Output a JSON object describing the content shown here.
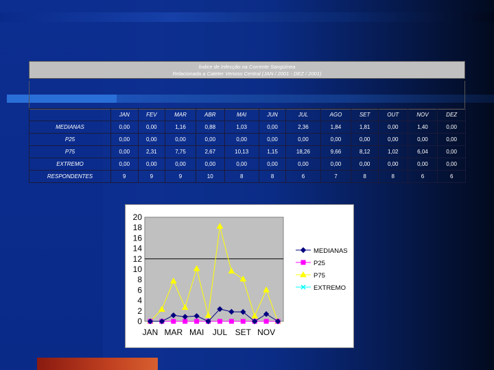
{
  "slide": {
    "title_line1": "Índice de Infecção na Corrente Sangüínea",
    "title_line2": "Relacionada a Cateter Venoso Central (JAN / 2001 - DEZ / 2001)"
  },
  "table": {
    "months": [
      "JAN",
      "FEV",
      "MAR",
      "ABR",
      "MAI",
      "JUN",
      "JUL",
      "AGO",
      "SET",
      "OUT",
      "NOV",
      "DEZ"
    ],
    "rows": [
      {
        "label": "MEDIANAS",
        "values": [
          "0,00",
          "0,00",
          "1,16",
          "0,88",
          "1,03",
          "0,00",
          "2,36",
          "1,84",
          "1,81",
          "0,00",
          "1,40",
          "0,00"
        ]
      },
      {
        "label": "P25",
        "values": [
          "0,00",
          "0,00",
          "0,00",
          "0,00",
          "0,00",
          "0,00",
          "0,00",
          "0,00",
          "0,00",
          "0,00",
          "0,00",
          "0,00"
        ]
      },
      {
        "label": "P75",
        "values": [
          "0,00",
          "2,31",
          "7,75",
          "2,67",
          "10,13",
          "1,15",
          "18,26",
          "9,66",
          "8,12",
          "1,02",
          "6,04",
          "0,00"
        ]
      },
      {
        "label": "EXTREMO",
        "values": [
          "0,00",
          "0,00",
          "0,00",
          "0,00",
          "0,00",
          "0,00",
          "0,00",
          "0,00",
          "0,00",
          "0,00",
          "0,00",
          "0,00"
        ]
      },
      {
        "label": "RESPONDENTES",
        "values": [
          "9",
          "9",
          "9",
          "10",
          "8",
          "8",
          "6",
          "7",
          "8",
          "8",
          "6",
          "6"
        ]
      }
    ]
  },
  "chart_data": {
    "type": "line",
    "x": [
      "JAN",
      "FEV",
      "MAR",
      "ABR",
      "MAI",
      "JUN",
      "JUL",
      "AGO",
      "SET",
      "OUT",
      "NOV",
      "DEZ"
    ],
    "xtick_labels": [
      "JAN",
      "",
      "MAR",
      "",
      "MAI",
      "",
      "JUL",
      "",
      "SET",
      "",
      "NOV",
      ""
    ],
    "ylim": [
      0,
      20
    ],
    "yticks": [
      0,
      2,
      4,
      6,
      8,
      10,
      12,
      14,
      16,
      18,
      20
    ],
    "gridline_at": 12,
    "series": [
      {
        "name": "MEDIANAS",
        "color": "#000080",
        "marker": "diamond",
        "values": [
          0,
          0,
          1.16,
          0.88,
          1.03,
          0,
          2.36,
          1.84,
          1.81,
          0,
          1.4,
          0
        ]
      },
      {
        "name": "P25",
        "color": "#ff00ff",
        "marker": "square",
        "values": [
          0,
          0,
          0,
          0,
          0,
          0,
          0,
          0,
          0,
          0,
          0,
          0
        ]
      },
      {
        "name": "P75",
        "color": "#ffff00",
        "marker": "triangle",
        "values": [
          0,
          2.31,
          7.75,
          2.67,
          10.13,
          1.15,
          18.26,
          9.66,
          8.12,
          1.02,
          6.04,
          0
        ]
      },
      {
        "name": "EXTREMO",
        "color": "#00ffff",
        "marker": "x",
        "values": [
          0,
          0,
          0,
          0,
          0,
          0,
          0,
          0,
          0,
          0,
          0,
          0
        ]
      }
    ],
    "legend": "right"
  }
}
